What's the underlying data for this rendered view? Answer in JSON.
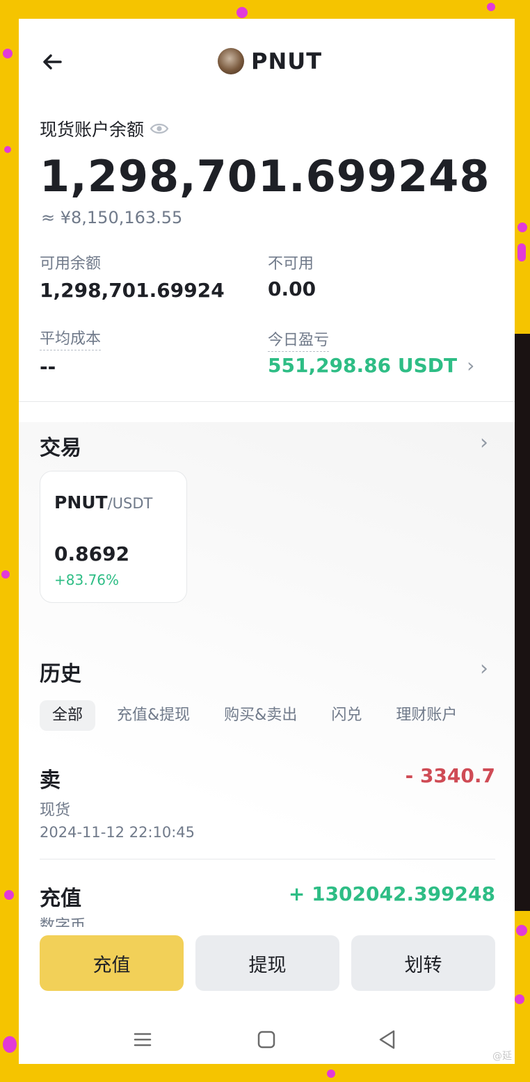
{
  "header": {
    "token_name": "PNUT"
  },
  "balance": {
    "label": "现货账户余额",
    "amount": "1,298,701.699248",
    "cny_approx": "≈ ¥8,150,163.55"
  },
  "stats": {
    "available_label": "可用余额",
    "available_value": "1,298,701.69924",
    "unavailable_label": "不可用",
    "unavailable_value": "0.00",
    "avg_cost_label": "平均成本",
    "avg_cost_value": "--",
    "today_pnl_label": "今日盈亏",
    "today_pnl_value": "551,298.86 USDT"
  },
  "trade": {
    "title": "交易",
    "pair": {
      "base": "PNUT",
      "quote": "/USDT",
      "price": "0.8692",
      "change": "+83.76%"
    }
  },
  "history": {
    "title": "历史",
    "tabs": [
      "全部",
      "充值&提现",
      "购买&卖出",
      "闪兑",
      "理财账户"
    ],
    "active_tab": "全部",
    "rows": [
      {
        "type": "卖",
        "amount": "- 3340.7",
        "sub": "现货",
        "time": "2024-11-12 22:10:45"
      },
      {
        "type": "充值",
        "amount": "+ 1302042.399248",
        "sub": "数字币"
      }
    ]
  },
  "actions": {
    "deposit": "充值",
    "withdraw": "提现",
    "transfer": "划转"
  },
  "watermark": "@延",
  "colors": {
    "accent": "#f2d058",
    "up": "#2ebd85",
    "down": "#cf4b55",
    "background": "#f5c400"
  },
  "icons": [
    "back-arrow-icon",
    "eye-icon",
    "chevron-right-icon",
    "menu-icon",
    "home-icon",
    "back-triangle-icon"
  ]
}
